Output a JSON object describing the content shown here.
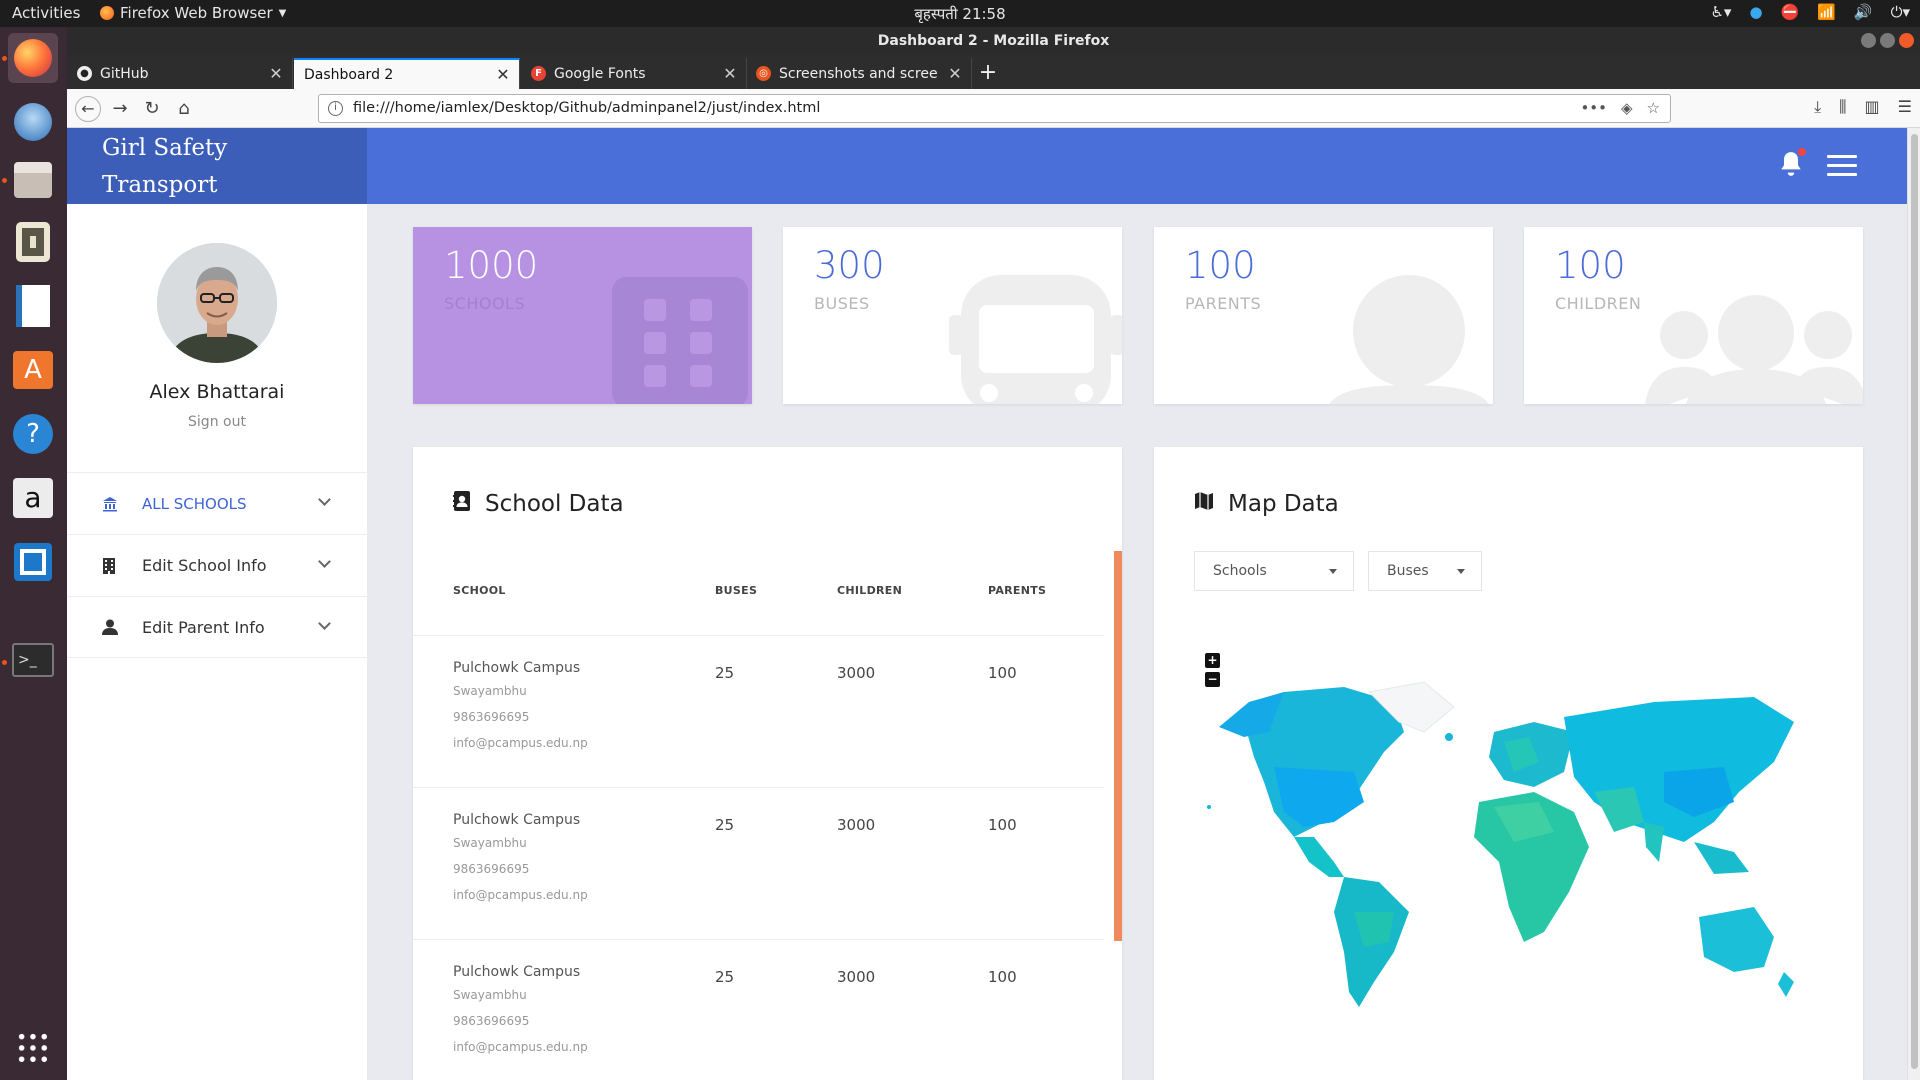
{
  "os": {
    "activities": "Activities",
    "app_menu": "Firefox Web Browser",
    "clock": "बृहस्पती 21:58"
  },
  "browser": {
    "window_title": "Dashboard 2 - Mozilla Firefox",
    "tabs": [
      {
        "label": "GitHub",
        "active": false
      },
      {
        "label": "Dashboard 2",
        "active": true
      },
      {
        "label": "Google Fonts",
        "active": false
      },
      {
        "label": "Screenshots and screenc",
        "active": false
      }
    ],
    "url": "file:///home/iamlex/Desktop/Github/adminpanel2/just/index.html"
  },
  "app": {
    "brand_line1": "Girl Safety",
    "brand_line2": "Transport",
    "colors": {
      "header": "#4b6fd9",
      "brand": "#3c5eb8",
      "accent": "#3f63d6",
      "purple_card": "#b892e2",
      "scroll_accent": "#f08a5d"
    }
  },
  "sidebar": {
    "profile_name": "Alex Bhattarai",
    "signout": "Sign out",
    "items": [
      {
        "label": "ALL SCHOOLS",
        "icon": "bank-icon",
        "active": true
      },
      {
        "label": "Edit School Info",
        "icon": "building-icon",
        "active": false
      },
      {
        "label": "Edit Parent Info",
        "icon": "user-icon",
        "active": false
      }
    ]
  },
  "stats": [
    {
      "value": "1000",
      "label": "SCHOOLS",
      "icon": "building-icon"
    },
    {
      "value": "300",
      "label": "BUSES",
      "icon": "bus-icon"
    },
    {
      "value": "100",
      "label": "PARENTS",
      "icon": "user-icon"
    },
    {
      "value": "100",
      "label": "CHILDREN",
      "icon": "users-icon"
    }
  ],
  "school_panel": {
    "title": "School Data",
    "columns": [
      "SCHOOL",
      "BUSES",
      "CHILDREN",
      "PARENTS"
    ],
    "rows": [
      {
        "name": "Pulchowk Campus",
        "location": "Swayambhu",
        "phone": "9863696695",
        "email": "info@pcampus.edu.np",
        "buses": "25",
        "children": "3000",
        "parents": "100"
      },
      {
        "name": "Pulchowk Campus",
        "location": "Swayambhu",
        "phone": "9863696695",
        "email": "info@pcampus.edu.np",
        "buses": "25",
        "children": "3000",
        "parents": "100"
      },
      {
        "name": "Pulchowk Campus",
        "location": "Swayambhu",
        "phone": "9863696695",
        "email": "info@pcampus.edu.np",
        "buses": "25",
        "children": "3000",
        "parents": "100"
      }
    ]
  },
  "map_panel": {
    "title": "Map Data",
    "select1": "Schools",
    "select2": "Buses",
    "zoom_in": "+",
    "zoom_out": "−"
  }
}
